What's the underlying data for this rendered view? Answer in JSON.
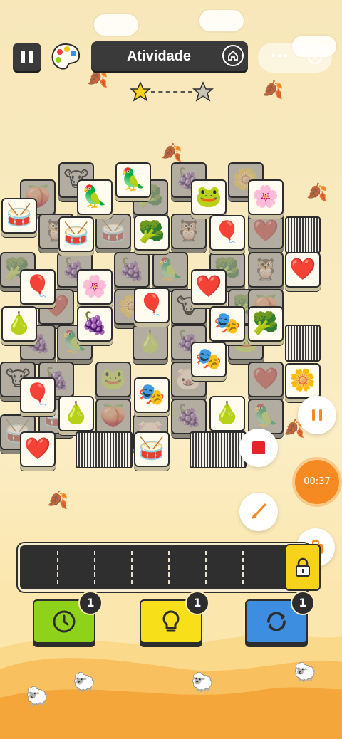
{
  "header": {
    "title": "Atividade",
    "menu_dots": "···",
    "close_symbol": "✕"
  },
  "progress": {
    "stars_total": 2,
    "stars_earned": 1
  },
  "board": {
    "tile_icons": {
      "drum": "🥁",
      "parrot": "🦜",
      "frog": "🐸",
      "flower": "🌸",
      "bush": "🥦",
      "balloons": "🎈",
      "heart": "❤️",
      "pear": "🍐",
      "grapes": "🍇",
      "mask": "🎭",
      "blueflower": "🌼",
      "owl": "🦉",
      "cow": "🐮",
      "pig": "🐷",
      "peach": "🍑"
    }
  },
  "controls": {
    "timer": "00:37"
  },
  "powerups": [
    {
      "name": "undo",
      "count": "1",
      "color": "#8fd21a"
    },
    {
      "name": "hint",
      "count": "1",
      "color": "#f7e01a"
    },
    {
      "name": "shuffle",
      "count": "1",
      "color": "#3d8de0"
    }
  ],
  "colors": {
    "accent": "#f58a22",
    "dark": "#3a3a3a",
    "background": "#fbe9b8"
  }
}
